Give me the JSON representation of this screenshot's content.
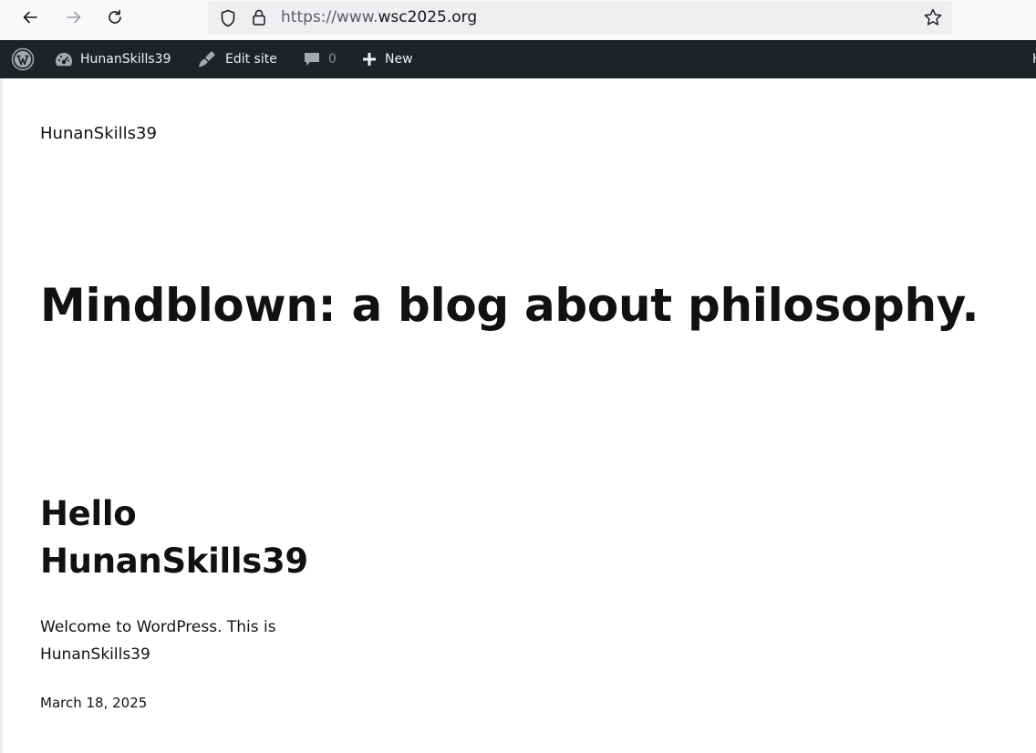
{
  "browser": {
    "url_scheme": "https://www.",
    "url_host": "wsc2025.org",
    "icons": [
      "back-icon",
      "forward-icon",
      "reload-icon",
      "shield-icon",
      "lock-icon",
      "bookmark-star-icon"
    ]
  },
  "admin_bar": {
    "site_name": "HunanSkills39",
    "edit_site_label": "Edit site",
    "comments_count": "0",
    "new_label": "New",
    "right_fragment": "H",
    "background": "#1d2327"
  },
  "page": {
    "site_title": "HunanSkills39",
    "tagline": "Mindblown: a blog about philosophy.",
    "post": {
      "title": "Hello HunanSkills39",
      "excerpt": "Welcome to WordPress. This is HunanSkills39",
      "date": "March 18, 2025"
    }
  }
}
